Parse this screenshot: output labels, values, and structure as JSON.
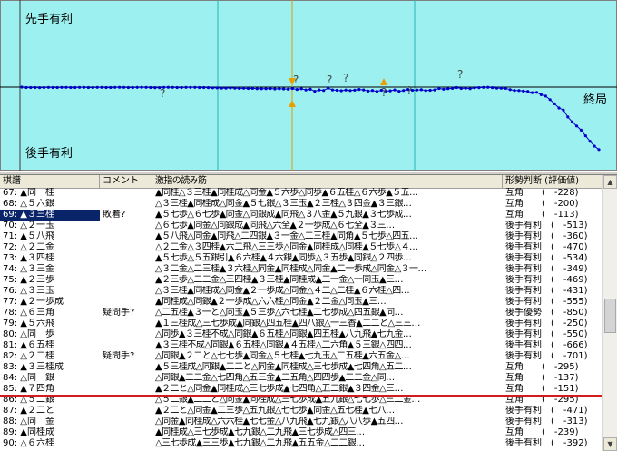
{
  "graph": {
    "sente_label": "先手有利",
    "gote_label": "後手有利",
    "end_label": "終局",
    "question_mark": "?",
    "evaluations": [
      0,
      -6,
      -6,
      -6,
      -8,
      -6,
      -4,
      -6,
      -6,
      -4,
      -4,
      -6,
      -6,
      -4,
      -4,
      -6,
      -6,
      -4,
      -4,
      -6,
      -6,
      -4,
      -2,
      -4,
      -6,
      -6,
      -4,
      -2,
      -4,
      -6,
      -8,
      -8,
      -4,
      -2,
      -4,
      -6,
      -6,
      -4,
      -4,
      -4,
      -6,
      -6,
      -8,
      -10,
      -12,
      -14,
      -14,
      -12,
      -14,
      -18,
      -16,
      -20,
      -18,
      -22,
      -24,
      -22,
      -20,
      -26,
      -22,
      -26,
      -30,
      -20,
      -34,
      -24,
      -40,
      -32,
      -60,
      -40,
      -48,
      -14,
      -40,
      -46,
      -52,
      -42,
      -50,
      -44,
      -34,
      -40,
      -58,
      -48,
      -62,
      -46,
      -58,
      -54,
      -40,
      -60,
      -48,
      -34,
      -46,
      -42,
      -38,
      -50,
      -46,
      -40,
      -20,
      -30,
      -22,
      -18,
      -6,
      -20,
      -14,
      -22,
      -10,
      -8,
      -4,
      -2,
      -8,
      -14,
      -16,
      -18,
      -36,
      -48,
      -50,
      -58,
      -62,
      -80,
      -76,
      -110,
      -130,
      -180,
      -240,
      -300,
      -330,
      -430,
      -500,
      -560,
      -620,
      -700,
      -780,
      -850,
      -900
    ]
  },
  "list": {
    "headers": {
      "move": "棋譜",
      "comment": "コメント",
      "pv": "激指の読み筋",
      "judge": "形勢判断 (評価値)"
    },
    "rows": [
      {
        "move": "67: ▲同　桂",
        "comment": "",
        "pv": "▲同桂△３三桂▲同桂成△同金▲５六歩△同歩▲６五桂△６六歩▲５五…",
        "judge": "互角　　(　-228)"
      },
      {
        "move": "68: △５六銀",
        "comment": "",
        "pv": "△３三桂▲同桂成△同金▲５七銀△３三玉▲２三桂△３四金▲３三銀…",
        "judge": "互角　　(　-200)"
      },
      {
        "move": "69: ▲３三桂",
        "comment": "敗着?",
        "pv": "▲５七歩△６七歩▲同金△同銀成▲同飛△３八金▲５九銀▲３七歩成…",
        "judge": "互角　　(　-113)"
      },
      {
        "move": "70: △２一玉",
        "comment": "",
        "pv": "△６七歩▲同金△同銀成▲同飛△六全▲２一歩成△６七全▲３三…",
        "judge": "後手有利　(　-513)"
      },
      {
        "move": "71: ▲５八飛",
        "comment": "",
        "pv": "▲５八飛△同金▲同飛△二四銀▲３一金△二三桂▲同角▲５七歩△四五…",
        "judge": "後手有利　(　-360)"
      },
      {
        "move": "72: △２二金",
        "comment": "",
        "pv": "△２二金△３四桂▲六二飛△三三歩△同金▲同桂成△同桂▲５七歩△４…",
        "judge": "後手有利　(　-470)"
      },
      {
        "move": "73: ▲３四桂",
        "comment": "",
        "pv": "▲５七歩△５五銀引▲６六桂▲４六銀▲同歩△３五歩▲同銀△２四歩…",
        "judge": "後手有利　(　-534)"
      },
      {
        "move": "74: △３三金",
        "comment": "",
        "pv": "△３二金△二三桂▲３六桂△同金▲同桂成△同金▲二一歩成△同金△３一…",
        "judge": "後手有利　(　-349)"
      },
      {
        "move": "75: ▲２三歩",
        "comment": "",
        "pv": "▲２三歩△二二金△三四桂▲３三桂▲同桂成▲二一金△一同玉▲三…",
        "judge": "後手有利　(　-469)"
      },
      {
        "move": "76: △３三玉",
        "comment": "",
        "pv": "△３三桂▲同桂成△同金▲２一歩成△同金△４二△二桂▲６六桂△四…",
        "judge": "後手有利　(　-431)"
      },
      {
        "move": "77: ▲２一歩成",
        "comment": "",
        "pv": "▲同桂成△同銀▲２一歩成△六六桂△同金▲２二金△同玉▲三…",
        "judge": "後手有利　(　-555)"
      },
      {
        "move": "78: △６三角",
        "comment": "疑問手?",
        "pv": "△二五桂▲３一と△同玉▲５三歩△六七桂▲二七歩成△四五銀▲同…",
        "judge": "後手優勢　(　-850)"
      },
      {
        "move": "79: ▲５六飛",
        "comment": "",
        "pv": "▲１三桂成△三七歩成▲同銀△四五桂▲四八銀△一三香▲二二と△三三…",
        "judge": "後手有利　(　-250)"
      },
      {
        "move": "80: △同　歩",
        "comment": "",
        "pv": "△同歩▲３三桂不成△同銀▲６五桂△同銀▲四五桂▲八九飛▲七九金…",
        "judge": "後手有利　(　-550)"
      },
      {
        "move": "81: ▲６五桂",
        "comment": "",
        "pv": "▲３三桂不成△同銀▲６五桂△同銀▲４五桂△二六角▲５三銀△四四…",
        "judge": "後手有利　(　-666)"
      },
      {
        "move": "82: △２二桂",
        "comment": "疑問手?",
        "pv": "△同銀▲２二と△七七歩▲同金△５七桂▲七九玉△二五桂▲六五金△…",
        "judge": "後手有利　(　-701)"
      },
      {
        "move": "83: ▲３三桂成",
        "comment": "",
        "pv": "▲５三桂成△同銀▲二二と△同金▲同桂成△三七歩成▲七四角△五二…",
        "judge": "互角　　(　-295)"
      },
      {
        "move": "84: △同　銀",
        "comment": "",
        "pv": "△同銀▲二二金△七四角△五三金▲二五角△四四歩▲二二金△同…",
        "judge": "互角　　(　-137)"
      },
      {
        "move": "85: ▲７四角",
        "comment": "",
        "pv": "▲２二と△同金▲同桂成△三七歩成▲七四角△五二銀▲３四金△三…",
        "judge": "互角　　(　-151)"
      },
      {
        "move": "86: △５二銀",
        "comment": "",
        "pv": "△５二銀▲二二と△同金▲同桂成△三七歩成▲五九銀△七七歩△三二金…",
        "judge": "互角　　(　-295)"
      },
      {
        "move": "87: ▲２二と",
        "comment": "",
        "pv": "▲２二と△同金▲二三歩△五九銀△七七歩▲同金△五七桂▲七八…",
        "judge": "後手有利　(　-471)"
      },
      {
        "move": "88: △同　金",
        "comment": "",
        "pv": "△同金▲同桂成△六六桂▲七七金△八九飛▲七九銀△八八歩▲五四…",
        "judge": "後手有利　(　-313)"
      },
      {
        "move": "89: ▲同桂成",
        "comment": "",
        "pv": "▲同桂成△三七歩成▲七九銀△二九飛▲三七歩成△四三…",
        "judge": "互角　　(　-239)"
      },
      {
        "move": "90: △６六桂",
        "comment": "",
        "pv": "△三七歩成▲三三歩▲七九銀△二九飛▲五五金△二二銀…",
        "judge": "後手有利　(　-392)"
      }
    ]
  }
}
